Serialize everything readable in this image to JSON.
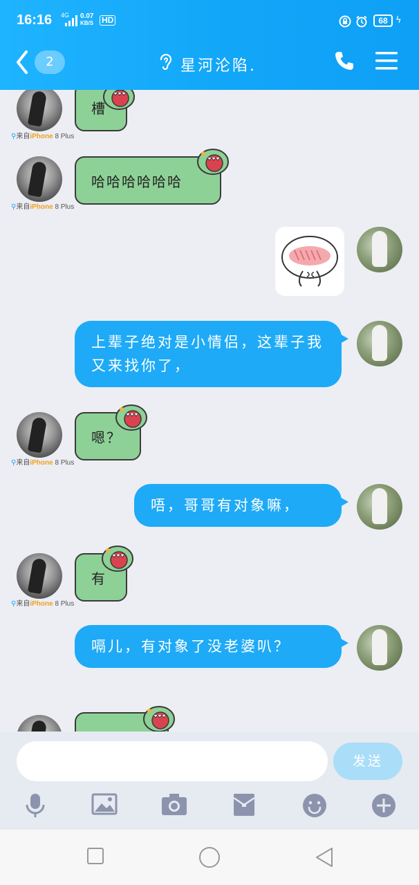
{
  "status_bar": {
    "time": "16:16",
    "network": "4G",
    "speed_value": "0.07",
    "speed_unit": "KB/S",
    "hd": "HD",
    "battery": "68"
  },
  "header": {
    "back_badge": "2",
    "title": "星河沦陷."
  },
  "device_label": {
    "pin": "⚲",
    "prefix": "来自",
    "hi": "iPhone",
    "suffix": " 8 Plus"
  },
  "messages": [
    {
      "side": "them",
      "text": "槽"
    },
    {
      "side": "them",
      "text": "哈哈哈哈哈哈"
    },
    {
      "side": "me",
      "text": "[sticker]"
    },
    {
      "side": "me",
      "text": "上辈子绝对是小情侣，这辈子我又来找你了，"
    },
    {
      "side": "them",
      "text": "嗯？"
    },
    {
      "side": "me",
      "text": "唔，哥哥有对象嘛，"
    },
    {
      "side": "them",
      "text": "有"
    },
    {
      "side": "me",
      "text": "嗝儿，有对象了没老婆叭？"
    }
  ],
  "input": {
    "placeholder": "",
    "send_label": "发送"
  },
  "colors": {
    "header": "#12a6f8",
    "bubble_me": "#1eaaf6",
    "bubble_them": "#8ed197",
    "send_disabled": "#a9ddf8"
  }
}
